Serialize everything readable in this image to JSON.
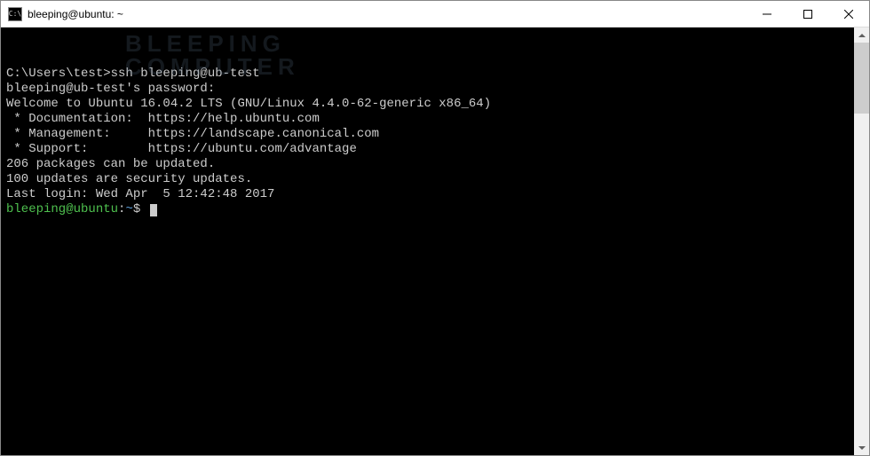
{
  "titlebar": {
    "title": "bleeping@ubuntu: ~",
    "icon_text": "C:\\"
  },
  "watermark": {
    "line1": "BLEEPING",
    "line2": "COMPUTER"
  },
  "terminal": {
    "line1": "C:\\Users\\test>ssh bleeping@ub-test",
    "line2": "bleeping@ub-test's password:",
    "line3": "Welcome to Ubuntu 16.04.2 LTS (GNU/Linux 4.4.0-62-generic x86_64)",
    "line4": "",
    "line5": " * Documentation:  https://help.ubuntu.com",
    "line6": " * Management:     https://landscape.canonical.com",
    "line7": " * Support:        https://ubuntu.com/advantage",
    "line8": "",
    "line9": "206 packages can be updated.",
    "line10": "100 updates are security updates.",
    "line11": "",
    "line12": "",
    "line13": "Last login: Wed Apr  5 12:42:48 2017",
    "prompt": {
      "user_host": "bleeping@ubuntu",
      "colon": ":",
      "path": "~",
      "dollar": "$"
    }
  }
}
